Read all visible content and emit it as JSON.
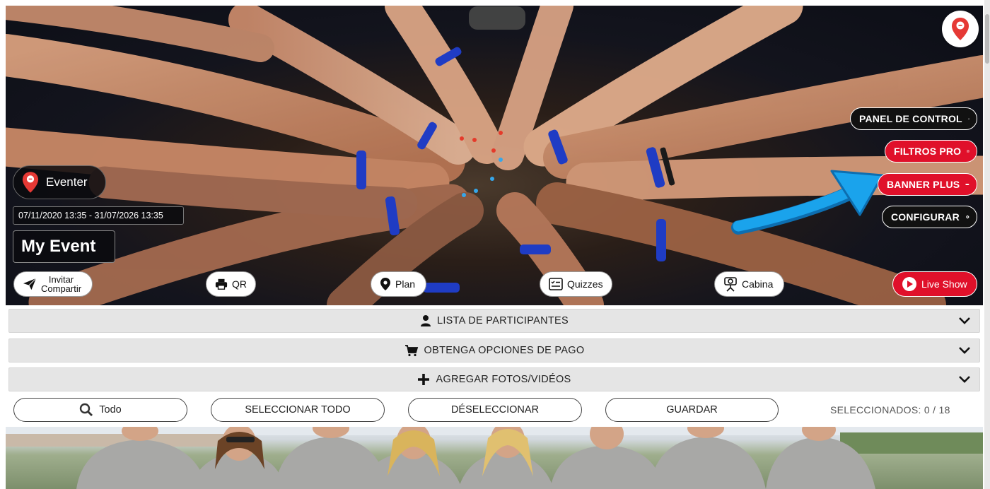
{
  "hero": {
    "event_brand": "Eventer",
    "date_range": "07/11/2020 13:35 - 31/07/2026 13:35",
    "event_title": "My Event"
  },
  "side_menu": {
    "panel_label": "PANEL DE CONTROL",
    "filters_label": "FILTROS PRO",
    "banner_label": "BANNER PLUS",
    "config_label": "CONFIGURAR"
  },
  "bottom_actions": {
    "invite_line1": "Invitar",
    "invite_line2": "Compartir",
    "qr_label": "QR",
    "plan_label": "Plan",
    "quizzes_label": "Quizzes",
    "cabina_label": "Cabina",
    "live_label": "Live Show"
  },
  "accordions": [
    {
      "label": "LISTA DE PARTICIPANTES",
      "icon": "person-icon"
    },
    {
      "label": "OBTENGA OPCIONES DE PAGO",
      "icon": "cart-icon"
    },
    {
      "label": "AGREGAR FOTOS/VIDÉOS",
      "icon": "plus-icon"
    }
  ],
  "toolbar": {
    "filter_label": "Todo",
    "select_all_label": "SELECCIONAR TODO",
    "deselect_label": "DÉSELECCIONAR",
    "save_label": "GUARDAR",
    "selected_count": "SELECCIONADOS: 0 / 18"
  },
  "colors": {
    "accent_red": "#e0102a",
    "highlight_arrow": "#1aa3ec",
    "accordion_bg": "#e5e5e5"
  }
}
